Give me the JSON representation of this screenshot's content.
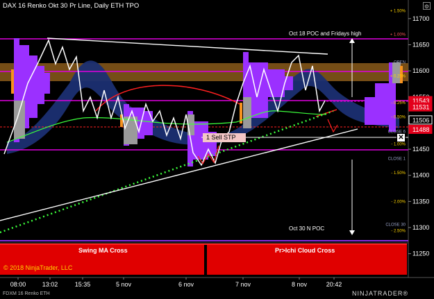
{
  "window": {
    "title": "DAX 16 Renko Okt 30 Pr Line, Daily ETH TPO",
    "tab": "FDXM 16 Renko ETH",
    "brand": "NINJATRADER®",
    "copyright": "© 2018 NinjaTrader, LLC",
    "settings_icon": "gear-icon"
  },
  "price_axis": {
    "labels": [
      "11700",
      "11650",
      "11600",
      "11550",
      "11450",
      "11400",
      "11350",
      "11300",
      "11250"
    ],
    "values": [
      11700,
      11650,
      11600,
      11550,
      11450,
      11400,
      11350,
      11300,
      11250
    ],
    "range": [
      11215,
      11725
    ]
  },
  "price_tags": [
    {
      "text": "11543",
      "value": 11543,
      "color": "#e3001b"
    },
    {
      "text": "11531",
      "value": 11531,
      "color": "#e3001b"
    },
    {
      "text": "11506",
      "value": 11506,
      "color": "#000000",
      "border": "#ffffff"
    },
    {
      "text": "11488",
      "value": 11488,
      "color": "#e3001b"
    }
  ],
  "percent_labels": [
    {
      "text": "+ 1.50%",
      "value": 11715,
      "color": "#ffd400"
    },
    {
      "text": "+ 1.00%",
      "value": 11670,
      "color": "#ff5a5a"
    },
    {
      "text": "+ 0.25%",
      "value": 11590,
      "color": "#ffd400"
    },
    {
      "text": "- 0.25%",
      "value": 11539,
      "color": "#ffd400"
    },
    {
      "text": "- 0.50%",
      "value": 11512,
      "color": "#ffd400"
    },
    {
      "text": "- 1.00%",
      "value": 11460,
      "color": "#ffd400"
    },
    {
      "text": "- 1.50%",
      "value": 11405,
      "color": "#ffd400"
    },
    {
      "text": "- 2.00%",
      "value": 11350,
      "color": "#ffd400"
    },
    {
      "text": "- 2.50%",
      "value": 11294,
      "color": "#ffd400"
    }
  ],
  "level_labels": [
    {
      "text": "OPEN",
      "value": 11617
    },
    {
      "text": "CLOSE 6",
      "value": 11484
    },
    {
      "text": "CLOSE 1",
      "value": 11432
    },
    {
      "text": "CLOSE 30",
      "value": 11306
    }
  ],
  "time_axis": [
    "08:00",
    "13:02",
    "15:35",
    "5 nov",
    "6 nov",
    "7 nov",
    "8 nov",
    "20:42"
  ],
  "annotations": {
    "top": "Oct 18 POC and Fridays high",
    "bottom": "Oct 30 N POC"
  },
  "orders": {
    "sell_label": "1  Sell STP",
    "close_symbol": "✕"
  },
  "indicators": {
    "left_panel": "Swing MA Cross",
    "right_panel": "Pr>Ichi Cloud Cross"
  },
  "colors": {
    "background": "#000000",
    "tpo_purple": "#9b30ff",
    "tpo_grey": "#9a9a9a",
    "poc_orange": "#f7931e",
    "panel_red": "#e00000",
    "magenta_line": "#e000e0",
    "cloud_blue": "#1f3a8a"
  }
}
